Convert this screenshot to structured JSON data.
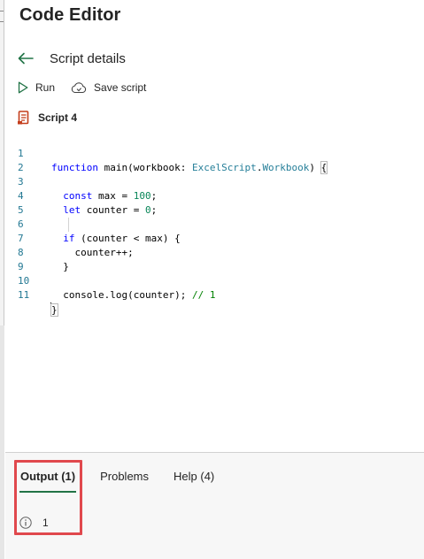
{
  "header": {
    "title": "Code Editor"
  },
  "nav": {
    "back_title": "Script details"
  },
  "toolbar": {
    "run_label": "Run",
    "save_label": "Save script"
  },
  "script": {
    "name": "Script 4"
  },
  "editor": {
    "line_numbers": [
      "1",
      "2",
      "3",
      "4",
      "5",
      "6",
      "7",
      "8",
      "9",
      "10",
      "11"
    ],
    "lines": [
      "function main(workbook: ExcelScript.Workbook) {",
      "",
      "  const max = 100;",
      "  let counter = 0;",
      "",
      "  if (counter < max) {",
      "    counter++;",
      "  }",
      "",
      "  console.log(counter); // 1",
      "}"
    ]
  },
  "panel": {
    "tabs": [
      {
        "label": "Output (1)",
        "active": true
      },
      {
        "label": "Problems",
        "active": false
      },
      {
        "label": "Help (4)",
        "active": false
      }
    ],
    "output_value": "1"
  },
  "colors": {
    "accent": "#217346",
    "highlight": "#e0484d",
    "line_number": "#237893"
  },
  "icons": {
    "back": "arrow-left-icon",
    "run": "play-icon",
    "save": "cloud-save-icon",
    "script": "script-file-icon",
    "info": "info-icon"
  }
}
